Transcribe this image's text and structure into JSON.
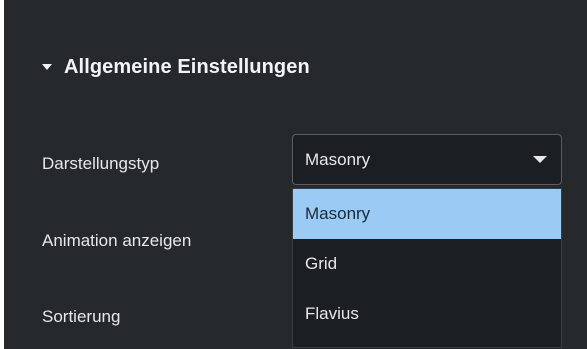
{
  "section": {
    "title": "Allgemeine Einstellungen"
  },
  "rows": {
    "display_type_label": "Darstellungstyp",
    "animation_label": "Animation anzeigen",
    "sort_label": "Sortierung"
  },
  "display_type_select": {
    "value": "Masonry",
    "options": [
      "Masonry",
      "Grid",
      "Flavius"
    ],
    "highlighted_index": 0
  },
  "colors": {
    "panel_background": "#26292c",
    "text": "#e6e8ea",
    "option_highlight": "#9bcbf5"
  },
  "icons": {
    "section_toggle": "caret-down-icon",
    "select_toggle": "chevron-down-icon"
  }
}
